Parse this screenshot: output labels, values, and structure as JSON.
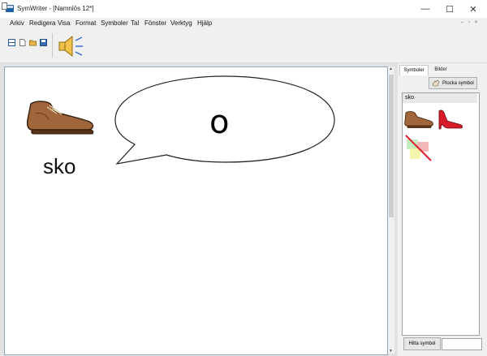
{
  "window": {
    "title": "SymWriter - [Namnlös 12*]",
    "controls": {
      "minimize": "—",
      "maximize": "☐",
      "close": "✕"
    }
  },
  "menu": {
    "items": [
      "Arkiv",
      "Redigera",
      "Visa",
      "Format",
      "Symboler",
      "Tal",
      "Fönster",
      "Verktyg",
      "Hjälp"
    ],
    "mdi_controls": "– ▫ ×"
  },
  "toolbar": {
    "icons": [
      "split-view-icon",
      "new-document-icon",
      "open-folder-icon",
      "save-icon",
      "speaker-icon"
    ]
  },
  "document": {
    "word": "sko",
    "bubble_text": "o",
    "symbol": "shoe-symbol"
  },
  "symbol_panel": {
    "tabs": [
      "Symboler",
      "Bilder"
    ],
    "active_tab": "Symboler",
    "pick_button": "Plocka symbol",
    "search_word": "sko",
    "results": [
      "brown-shoe-icon",
      "red-high-heel-icon",
      "no-symbol-icon"
    ],
    "find_button": "Hitta symbol",
    "find_input_value": ""
  }
}
